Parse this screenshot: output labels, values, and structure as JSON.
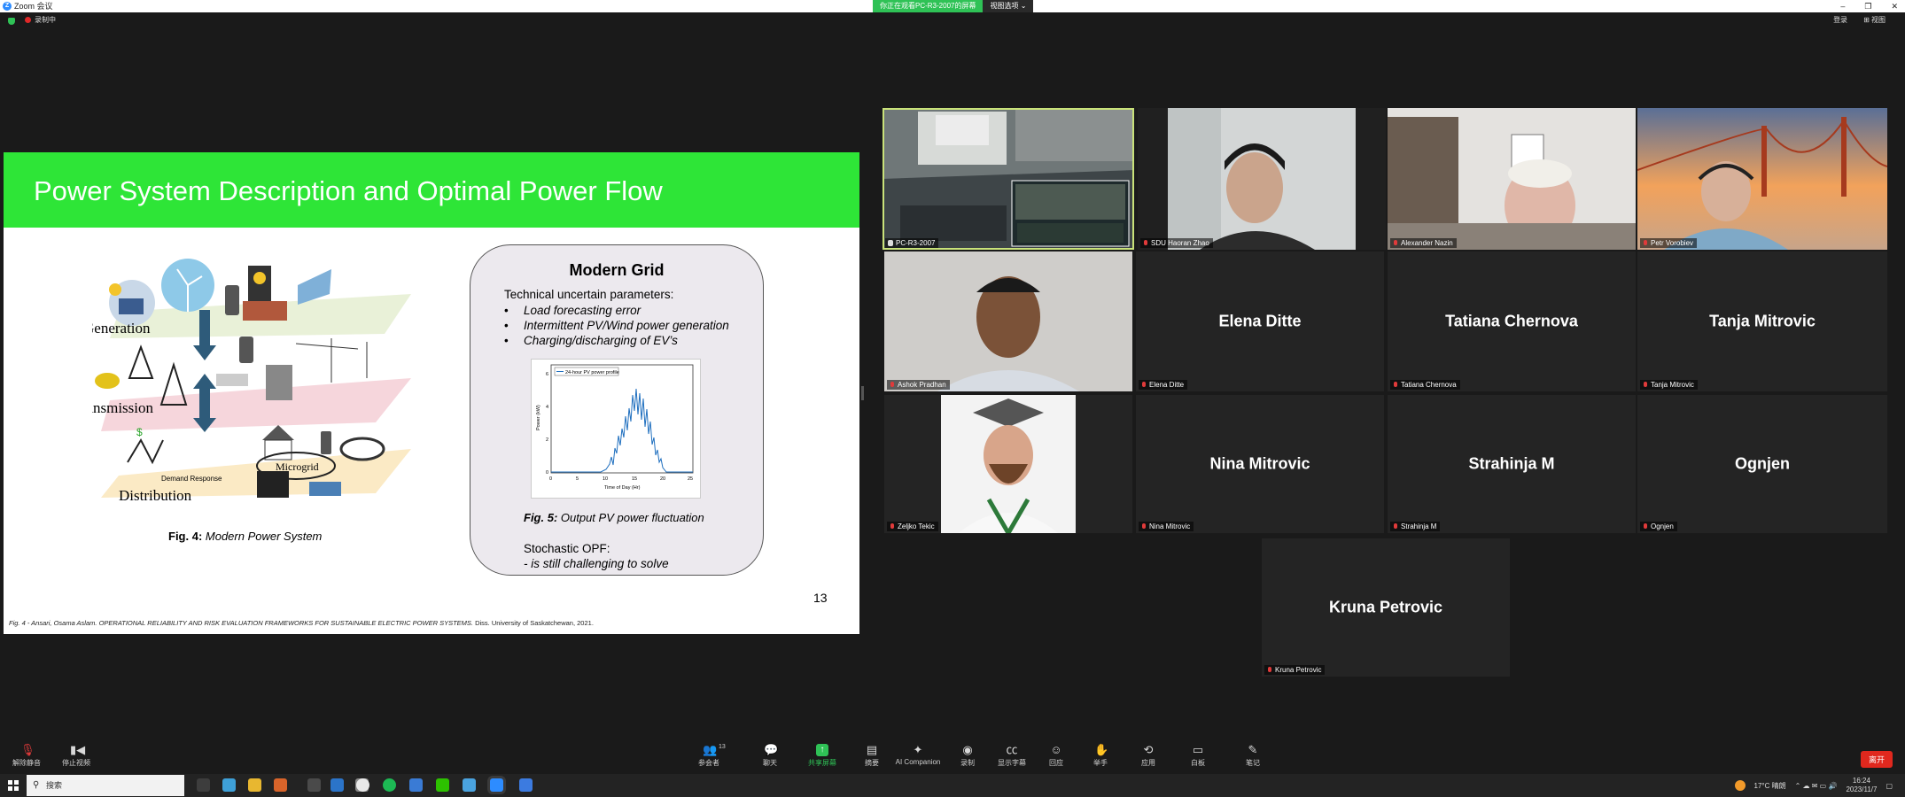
{
  "window": {
    "title": "Zoom 会议",
    "share_status": "你正在观看PC-R3-2007的屏幕",
    "view_options": "视图选项 ⌄",
    "controls": [
      "–",
      "❐",
      "✕"
    ]
  },
  "topbar": {
    "recording": "录制中",
    "login": "登录",
    "view": "⊞ 视图"
  },
  "slide": {
    "title": "Power System Description and Optimal Power Flow",
    "diagram_labels": {
      "generation": "Generation",
      "transmission": "Transmission",
      "distribution": "Distribution",
      "microgrid": "Microgrid",
      "demand_response": "Demand Response",
      "dollar": "$"
    },
    "fig4_bold": "Fig. 4:",
    "fig4_text": " Modern Power System",
    "modern_grid_title": "Modern Grid",
    "modern_grid_sub": "Technical uncertain parameters:",
    "modern_grid_items": [
      "Load forecasting error",
      "Intermittent PV/Wind power generation",
      "Charging/discharging of EV’s"
    ],
    "pv_plot_legend": "24-hour PV power profile",
    "pv_plot_xlabel": "Time of Day (Hr)",
    "pv_plot_ylabel": "Power (kW)",
    "pv_plot_xticks": [
      "0",
      "5",
      "10",
      "15",
      "20",
      "25"
    ],
    "pv_plot_yticks": [
      "0",
      "2",
      "4",
      "6"
    ],
    "fig5_bold": "Fig. 5:",
    "fig5_text": " Output PV power fluctuation",
    "stochastic_line1": "Stochastic OPF:",
    "stochastic_line2": "- is still challenging to solve",
    "page_number": "13",
    "footnote_plain": "Fig. 4 - Ansari, Osama Aslam. ",
    "footnote_italic": "OPERATIONAL RELIABILITY AND RISK EVALUATION FRAMEWORKS FOR SUSTAINABLE ELECTRIC POWER SYSTEMS.",
    "footnote_tail": " Diss. University of Saskatchewan, 2021."
  },
  "participants": [
    {
      "name": "PC-R3-2007",
      "video": true,
      "active": true
    },
    {
      "name": "SDU Haoran Zhao",
      "video": true
    },
    {
      "name": "Alexander Nazin",
      "video": true
    },
    {
      "name": "Petr Vorobiev",
      "video": true
    },
    {
      "name": "Ashok Pradhan",
      "video": true
    },
    {
      "name": "Elena Ditte",
      "video": false
    },
    {
      "name": "Tatiana Chernova",
      "video": false
    },
    {
      "name": "Tanja Mitrovic",
      "video": false
    },
    {
      "name": "Zeljko Tekic",
      "video": true
    },
    {
      "name": "Nina Mitrovic",
      "video": false
    },
    {
      "name": "Strahinja M",
      "video": false
    },
    {
      "name": "Ognjen",
      "video": false
    },
    {
      "name": "Kruna Petrovic",
      "video": false
    }
  ],
  "toolbar": {
    "unmute": "解除静音",
    "start_video": "停止视频",
    "participants": "参会者",
    "participants_count": "13",
    "chat": "聊天",
    "share_screen": "共享屏幕",
    "summary": "摘要",
    "ai_companion": "AI Companion",
    "record": "录制",
    "captions": "显示字幕",
    "reactions": "回应",
    "raise_hand": "举手",
    "apps": "应用",
    "whiteboard": "白板",
    "notes": "笔记",
    "leave": "离开"
  },
  "taskbar": {
    "search_placeholder": "搜索",
    "weather": "17°C  晴朗",
    "time": "16:24",
    "date": "2023/11/7"
  },
  "colors": {
    "slide_header": "#2ee537",
    "zoom_green": "#2fc256",
    "leave_red": "#e0281e",
    "active_speaker": "#c9e27a"
  }
}
